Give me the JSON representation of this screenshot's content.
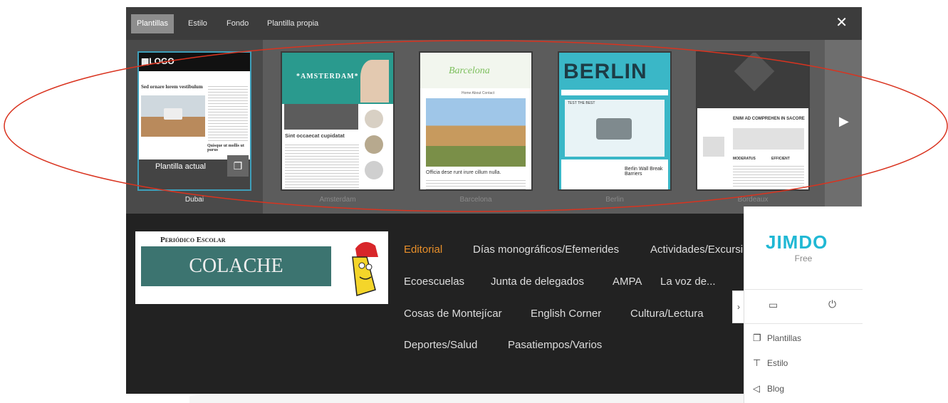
{
  "topbar": {
    "tabs": [
      {
        "label": "Plantillas"
      },
      {
        "label": "Estilo"
      },
      {
        "label": "Fondo"
      },
      {
        "label": "Plantilla propia"
      }
    ],
    "close": "✕"
  },
  "templates": {
    "current_label": "Plantilla actual",
    "items": [
      {
        "name": "Dubai"
      },
      {
        "name": "Amsterdam"
      },
      {
        "name": "Barcelona"
      },
      {
        "name": "Berlin"
      },
      {
        "name": "Bordeaux"
      }
    ],
    "thumb_texts": {
      "dubai_logo": "▦LOGO",
      "dubai_heading": "Sed ornare lorem vestibulum",
      "dubai_sub": "Quisque ut mollis ut purus",
      "amsterdam_logo": "*AMSTERDAM*",
      "amsterdam_heading": "Sint occaecat cupidatat",
      "barcelona_logo": "Barcelona",
      "barcelona_menu": "Home  About  Contact",
      "barcelona_caption": "Officia dese runt irure cillum nulla.",
      "berlin_logo": "BERLIN",
      "berlin_tag": "TEST THE BEST",
      "berlin_caption": "Berlin Wall Break Barriers",
      "bordeaux_heading": "ENIM AD COMPREHEN IN SACORE",
      "bordeaux_col1": "MODERATUS",
      "bordeaux_col2": "EFFICIENT"
    }
  },
  "site": {
    "logo": {
      "line1": "Periódico Escolar",
      "title": "COLACHE"
    },
    "nav": [
      {
        "label": "Editorial",
        "active": true
      },
      {
        "label": "Días monográficos/Efemerides"
      },
      {
        "label": "Actividades/Excursi"
      },
      {
        "label": "Ecoescuelas"
      },
      {
        "label": "Junta de delegados"
      },
      {
        "label": "AMPA"
      },
      {
        "label": "La voz de..."
      },
      {
        "label": "Cosas de Montejícar"
      },
      {
        "label": "English Corner"
      },
      {
        "label": "Cultura/Lectura"
      },
      {
        "label": "Deportes/Salud"
      },
      {
        "label": "Pasatiempos/Varios"
      }
    ]
  },
  "panel": {
    "brand": "JIMDO",
    "plan": "Free",
    "toggle": "›",
    "items": [
      {
        "label": "Plantillas",
        "icon": "templates-icon"
      },
      {
        "label": "Estilo",
        "icon": "brush-icon"
      },
      {
        "label": "Blog",
        "icon": "megaphone-icon"
      }
    ]
  },
  "colors": {
    "accent_orange": "#e88f2a",
    "jimdo_blue": "#20b8d4",
    "annotation_red": "#d9331f"
  }
}
